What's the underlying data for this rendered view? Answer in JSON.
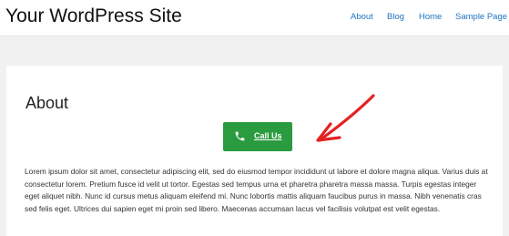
{
  "header": {
    "site_title": "Your WordPress Site",
    "nav": [
      "About",
      "Blog",
      "Home",
      "Sample Page"
    ]
  },
  "page": {
    "title": "About",
    "cta_label": "Call Us",
    "cta_icon": "phone-icon",
    "annotation_icon": "red-hand-drawn-arrow-icon",
    "annotation_color": "#e32222",
    "cta_color": "#2b9b3f",
    "link_color": "#1e73be",
    "body": "Lorem ipsum dolor sit amet, consectetur adipiscing elit, sed do eiusmod tempor incididunt ut labore et dolore magna aliqua. Varius duis at consectetur lorem. Pretium fusce id velit ut tortor. Egestas sed tempus urna et pharetra pharetra massa massa. Turpis egestas integer eget aliquet nibh. Nunc id cursus metus aliquam eleifend mi. Nunc lobortis mattis aliquam faucibus purus in massa. Nibh venenatis cras sed felis eget. Ultrices dui sapien eget mi proin sed libero. Maecenas accumsan lacus vel facilisis volutpat est velit egestas."
  }
}
